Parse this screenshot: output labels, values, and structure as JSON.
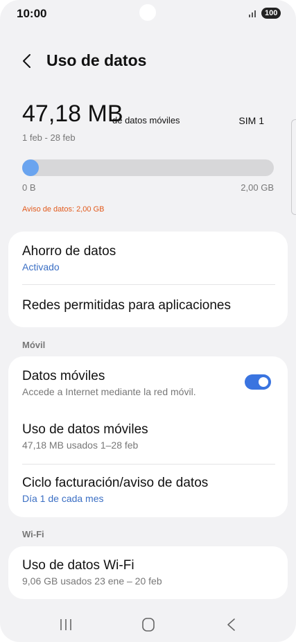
{
  "status": {
    "time": "10:00",
    "battery": "100"
  },
  "header": {
    "title": "Uso de datos",
    "back_icon": "chevron-left-icon"
  },
  "usage": {
    "amount": "47,18 MB",
    "suffix": "de datos móviles",
    "sim": "SIM 1",
    "period": "1 feb - 28 feb",
    "bar_fill_fraction": 0.023,
    "bar_min": "0 B",
    "bar_max": "2,00 GB",
    "warning": "Aviso de datos: 2,00 GB",
    "colors": {
      "bar_fill": "#6aa4ef",
      "warning": "#e25a1c"
    }
  },
  "card1": {
    "saver_title": "Ahorro de datos",
    "saver_status": "Activado",
    "allowed_apps": "Redes permitidas para aplicaciones"
  },
  "mobile_section": {
    "label": "Móvil",
    "mobile_data_title": "Datos móviles",
    "mobile_data_sub": "Accede a Internet mediante la red móvil.",
    "mobile_data_on": true,
    "mobile_usage_title": "Uso de datos móviles",
    "mobile_usage_sub": "47,18 MB usados 1–28 feb",
    "billing_title": "Ciclo facturación/aviso de datos",
    "billing_sub": "Día 1 de cada mes"
  },
  "wifi_section": {
    "label": "Wi-Fi",
    "wifi_usage_title": "Uso de datos Wi-Fi",
    "wifi_usage_sub": "9,06 GB usados 23 ene – 20 feb"
  },
  "navbar": {
    "icons": [
      "recent-apps-icon",
      "home-icon",
      "back-icon"
    ]
  },
  "accent": "#3a74e0"
}
